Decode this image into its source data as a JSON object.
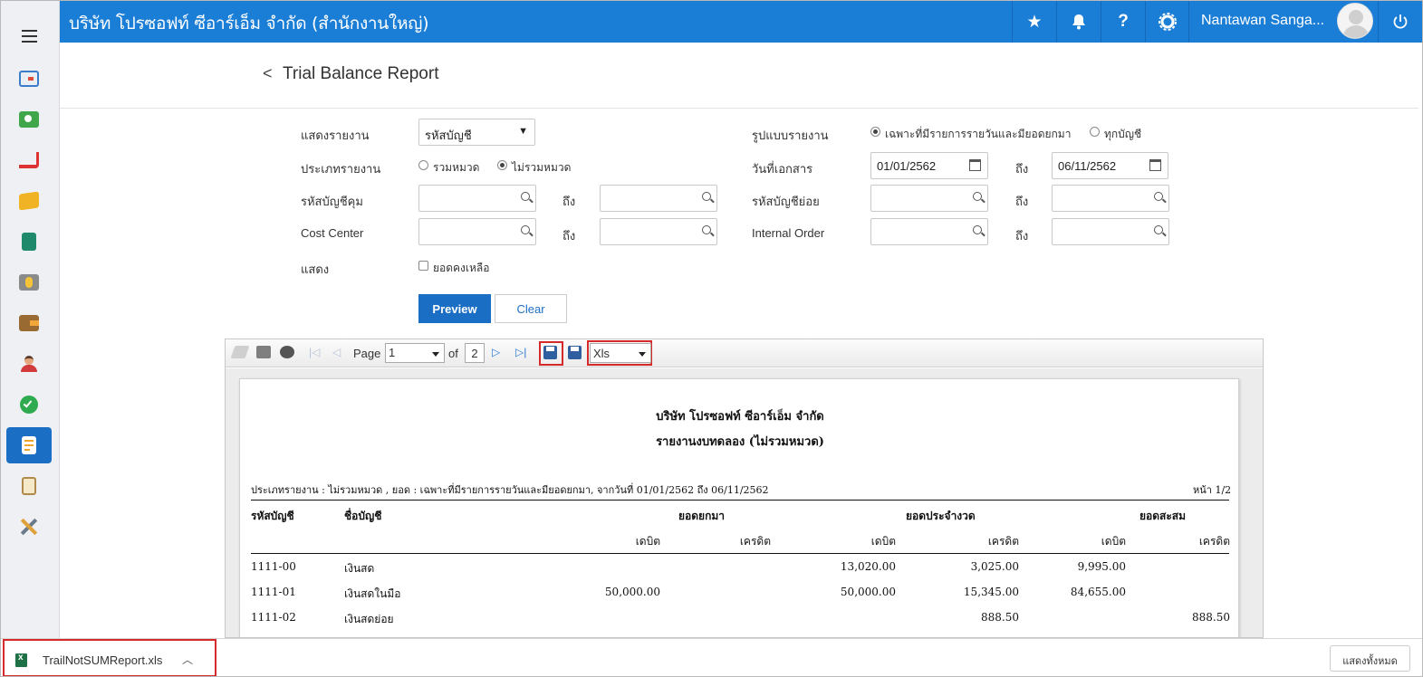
{
  "topbar": {
    "company": "บริษัท โปรซอฟท์ ซีอาร์เอ็ม จำกัด (สำนักงานใหญ่)",
    "user_name": "Nantawan Sanga...",
    "help_label": "?",
    "brand_color": "#1b7ed6"
  },
  "sidebar": {
    "items": [
      "dashboard-icon",
      "money-icon",
      "cart-icon",
      "box-icon",
      "book-icon",
      "bank-icon",
      "wallet-icon",
      "employee-icon",
      "check-icon",
      "report-icon",
      "clipboard-icon",
      "tools-icon"
    ],
    "active": "report-icon"
  },
  "page": {
    "title": "Trial Balance Report",
    "back": "<"
  },
  "form": {
    "show_report_label": "แสดงรายงาน",
    "show_report_value": "รหัสบัญชี",
    "report_type_label": "ประเภทรายงาน",
    "report_type_opt1": "รวมหมวด",
    "report_type_opt2": "ไม่รวมหมวด",
    "control_acct_label": "รหัสบัญชีคุม",
    "cost_center_label": "Cost Center",
    "show_label": "แสดง",
    "balance_label": "ยอดคงเหลือ",
    "format_label": "รูปแบบรายงาน",
    "format_opt1": "เฉพาะที่มีรายการรายวันและมียอดยกมา",
    "format_opt2": "ทุกบัญชี",
    "doc_date_label": "วันที่เอกสาร",
    "date_from": "01/01/2562",
    "date_to": "06/11/2562",
    "to_label": "ถึง",
    "sub_acct_label": "รหัสบัญชีย่อย",
    "internal_order_label": "Internal Order",
    "preview_label": "Preview",
    "clear_label": "Clear"
  },
  "viewer": {
    "page_label": "Page",
    "page_value": "1",
    "of_label": "of",
    "page_total": "2",
    "format_value": "Xls"
  },
  "report": {
    "company": "บริษัท โปรซอฟท์ ซีอาร์เอ็ม จำกัด",
    "title": "รายงานงบทดลอง (ไม่รวมหมวด)",
    "criteria": "ประเภทรายงาน : ไม่รวมหมวด , ยอด : เฉพาะที่มีรายการรายวันและมียอดยกมา, จากวันที่ 01/01/2562 ถึง 06/11/2562",
    "page_info": "หน้า 1/2",
    "col_code": "รหัสบัญชี",
    "col_name": "ชื่อบัญชี",
    "grp_bf": "ยอดยกมา",
    "grp_period": "ยอดประจำงวด",
    "grp_cum": "ยอดสะสม",
    "debit": "เดบิต",
    "credit": "เครดิต",
    "rows": [
      {
        "code": "1111-00",
        "name": "เงินสด",
        "bf_dr": "",
        "bf_cr": "",
        "pd_dr": "13,020.00",
        "pd_cr": "3,025.00",
        "cm_dr": "9,995.00",
        "cm_cr": ""
      },
      {
        "code": "1111-01",
        "name": "เงินสดในมือ",
        "bf_dr": "50,000.00",
        "bf_cr": "",
        "pd_dr": "50,000.00",
        "pd_cr": "15,345.00",
        "cm_dr": "84,655.00",
        "cm_cr": ""
      },
      {
        "code": "1111-02",
        "name": "เงินสดย่อย",
        "bf_dr": "",
        "bf_cr": "",
        "pd_dr": "",
        "pd_cr": "888.50",
        "cm_dr": "",
        "cm_cr": "888.50"
      }
    ]
  },
  "downloads": {
    "file_name": "TrailNotSUMReport.xls",
    "show_all": "แสดงทั้งหมด"
  }
}
